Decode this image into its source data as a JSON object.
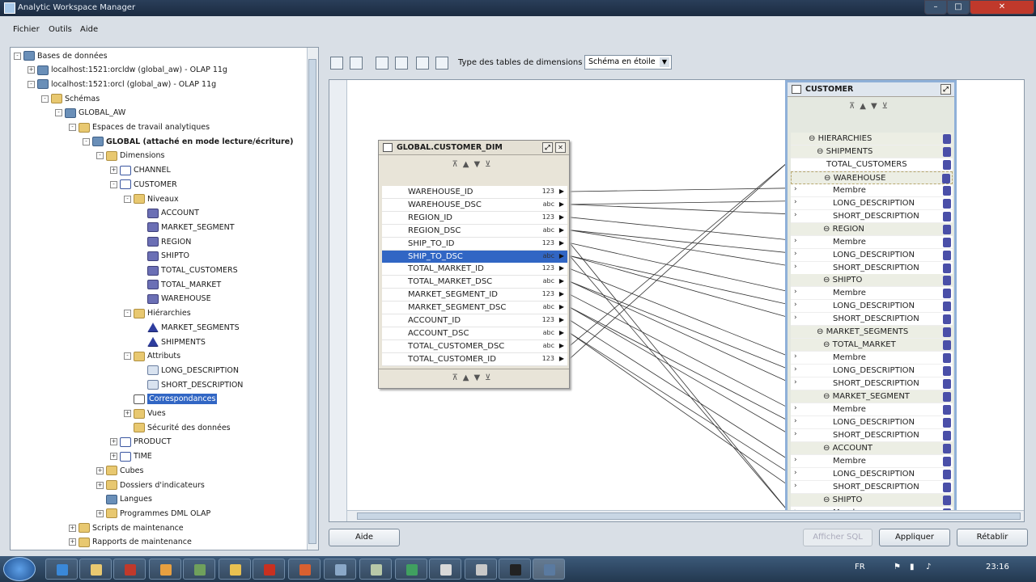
{
  "window": {
    "title": "Analytic Workspace Manager"
  },
  "menu": [
    "Fichier",
    "Outils",
    "Aide"
  ],
  "tree": [
    {
      "label": "Bases de données",
      "indent": 0,
      "icon": "db",
      "exp": "-"
    },
    {
      "label": "localhost:1521:orcldw (global_aw) - OLAP 11g",
      "indent": 1,
      "icon": "db",
      "exp": "+"
    },
    {
      "label": "localhost:1521:orcl (global_aw) - OLAP 11g",
      "indent": 1,
      "icon": "db",
      "exp": "-"
    },
    {
      "label": "Schémas",
      "indent": 2,
      "icon": "folder",
      "exp": "-"
    },
    {
      "label": "GLOBAL_AW",
      "indent": 3,
      "icon": "db",
      "exp": "-"
    },
    {
      "label": "Espaces de travail analytiques",
      "indent": 4,
      "icon": "folder",
      "exp": "-"
    },
    {
      "label": "GLOBAL (attaché en mode lecture/écriture)",
      "indent": 5,
      "icon": "db",
      "exp": "-",
      "bold": true
    },
    {
      "label": "Dimensions",
      "indent": 6,
      "icon": "folder",
      "exp": "-"
    },
    {
      "label": "CHANNEL",
      "indent": 7,
      "icon": "dim",
      "exp": "+"
    },
    {
      "label": "CUSTOMER",
      "indent": 7,
      "icon": "dim",
      "exp": "-"
    },
    {
      "label": "Niveaux",
      "indent": 8,
      "icon": "folder",
      "exp": "-"
    },
    {
      "label": "ACCOUNT",
      "indent": 9,
      "icon": "level",
      "exp": ""
    },
    {
      "label": "MARKET_SEGMENT",
      "indent": 9,
      "icon": "level",
      "exp": ""
    },
    {
      "label": "REGION",
      "indent": 9,
      "icon": "level",
      "exp": ""
    },
    {
      "label": "SHIPTO",
      "indent": 9,
      "icon": "level",
      "exp": ""
    },
    {
      "label": "TOTAL_CUSTOMERS",
      "indent": 9,
      "icon": "level",
      "exp": ""
    },
    {
      "label": "TOTAL_MARKET",
      "indent": 9,
      "icon": "level",
      "exp": ""
    },
    {
      "label": "WAREHOUSE",
      "indent": 9,
      "icon": "level",
      "exp": ""
    },
    {
      "label": "Hiérarchies",
      "indent": 8,
      "icon": "folder",
      "exp": "-"
    },
    {
      "label": "MARKET_SEGMENTS",
      "indent": 9,
      "icon": "hier",
      "exp": ""
    },
    {
      "label": "SHIPMENTS",
      "indent": 9,
      "icon": "hier",
      "exp": ""
    },
    {
      "label": "Attributs",
      "indent": 8,
      "icon": "folder",
      "exp": "-"
    },
    {
      "label": "LONG_DESCRIPTION",
      "indent": 9,
      "icon": "attr",
      "exp": ""
    },
    {
      "label": "SHORT_DESCRIPTION",
      "indent": 9,
      "icon": "attr",
      "exp": ""
    },
    {
      "label": "Correspondances",
      "indent": 8,
      "icon": "map",
      "exp": "",
      "selected": true
    },
    {
      "label": "Vues",
      "indent": 8,
      "icon": "folder",
      "exp": "+"
    },
    {
      "label": "Sécurité des données",
      "indent": 8,
      "icon": "folder",
      "exp": ""
    },
    {
      "label": "PRODUCT",
      "indent": 7,
      "icon": "dim",
      "exp": "+"
    },
    {
      "label": "TIME",
      "indent": 7,
      "icon": "dim",
      "exp": "+"
    },
    {
      "label": "Cubes",
      "indent": 6,
      "icon": "folder",
      "exp": "+"
    },
    {
      "label": "Dossiers d'indicateurs",
      "indent": 6,
      "icon": "folder",
      "exp": "+"
    },
    {
      "label": "Langues",
      "indent": 6,
      "icon": "db",
      "exp": ""
    },
    {
      "label": "Programmes DML OLAP",
      "indent": 6,
      "icon": "folder",
      "exp": "+"
    },
    {
      "label": "Scripts de maintenance",
      "indent": 4,
      "icon": "folder",
      "exp": "+"
    },
    {
      "label": "Rapports de maintenance",
      "indent": 4,
      "icon": "folder",
      "exp": "+"
    }
  ],
  "toolbar": {
    "label": "Type des tables de dimensions :",
    "select_value": "Schéma en étoile"
  },
  "source": {
    "title": "GLOBAL.CUSTOMER_DIM",
    "columns": [
      {
        "name": "WAREHOUSE_ID",
        "type": "123"
      },
      {
        "name": "WAREHOUSE_DSC",
        "type": "abc"
      },
      {
        "name": "REGION_ID",
        "type": "123"
      },
      {
        "name": "REGION_DSC",
        "type": "abc"
      },
      {
        "name": "SHIP_TO_ID",
        "type": "123"
      },
      {
        "name": "SHIP_TO_DSC",
        "type": "abc",
        "selected": true
      },
      {
        "name": "TOTAL_MARKET_ID",
        "type": "123"
      },
      {
        "name": "TOTAL_MARKET_DSC",
        "type": "abc"
      },
      {
        "name": "MARKET_SEGMENT_ID",
        "type": "123"
      },
      {
        "name": "MARKET_SEGMENT_DSC",
        "type": "abc"
      },
      {
        "name": "ACCOUNT_ID",
        "type": "123"
      },
      {
        "name": "ACCOUNT_DSC",
        "type": "abc"
      },
      {
        "name": "TOTAL_CUSTOMER_DSC",
        "type": "abc"
      },
      {
        "name": "TOTAL_CUSTOMER_ID",
        "type": "123"
      }
    ]
  },
  "target": {
    "title": "CUSTOMER",
    "rows": [
      {
        "label": "HIERARCHIES",
        "group": true,
        "x": 30,
        "mark": "⊖"
      },
      {
        "label": "SHIPMENTS",
        "group": true,
        "x": 40,
        "mark": "⊖"
      },
      {
        "label": "TOTAL_CUSTOMERS",
        "x": 52,
        "arrow": false
      },
      {
        "label": "WAREHOUSE",
        "group": true,
        "x": 48,
        "mark": "⊖",
        "dashed": true
      },
      {
        "label": "Membre",
        "x": 60,
        "arrow": true
      },
      {
        "label": "LONG_DESCRIPTION",
        "x": 60,
        "arrow": true
      },
      {
        "label": "SHORT_DESCRIPTION",
        "x": 60,
        "arrow": true
      },
      {
        "label": "REGION",
        "group": true,
        "x": 48,
        "mark": "⊖"
      },
      {
        "label": "Membre",
        "x": 60,
        "arrow": true
      },
      {
        "label": "LONG_DESCRIPTION",
        "x": 60,
        "arrow": true
      },
      {
        "label": "SHORT_DESCRIPTION",
        "x": 60,
        "arrow": true
      },
      {
        "label": "SHIPTO",
        "group": true,
        "x": 48,
        "mark": "⊖"
      },
      {
        "label": "Membre",
        "x": 60,
        "arrow": true
      },
      {
        "label": "LONG_DESCRIPTION",
        "x": 60,
        "arrow": true
      },
      {
        "label": "SHORT_DESCRIPTION",
        "x": 60,
        "arrow": true
      },
      {
        "label": "MARKET_SEGMENTS",
        "group": true,
        "x": 40,
        "mark": "⊖"
      },
      {
        "label": "TOTAL_MARKET",
        "group": true,
        "x": 48,
        "mark": "⊖"
      },
      {
        "label": "Membre",
        "x": 60,
        "arrow": true
      },
      {
        "label": "LONG_DESCRIPTION",
        "x": 60,
        "arrow": true
      },
      {
        "label": "SHORT_DESCRIPTION",
        "x": 60,
        "arrow": true
      },
      {
        "label": "MARKET_SEGMENT",
        "group": true,
        "x": 48,
        "mark": "⊖"
      },
      {
        "label": "Membre",
        "x": 60,
        "arrow": true
      },
      {
        "label": "LONG_DESCRIPTION",
        "x": 60,
        "arrow": true
      },
      {
        "label": "SHORT_DESCRIPTION",
        "x": 60,
        "arrow": true
      },
      {
        "label": "ACCOUNT",
        "group": true,
        "x": 48,
        "mark": "⊖"
      },
      {
        "label": "Membre",
        "x": 60,
        "arrow": true
      },
      {
        "label": "LONG_DESCRIPTION",
        "x": 60,
        "arrow": true
      },
      {
        "label": "SHORT_DESCRIPTION",
        "x": 60,
        "arrow": true
      },
      {
        "label": "SHIPTO",
        "group": true,
        "x": 48,
        "mark": "⊖"
      },
      {
        "label": "Membre",
        "x": 60,
        "arrow": true
      }
    ]
  },
  "buttons": {
    "help": "Aide",
    "sql": "Afficher SQL",
    "apply": "Appliquer",
    "reset": "Rétablir"
  },
  "taskbar": {
    "lang": "FR",
    "time": "23:16"
  },
  "colors": {
    "selection": "#3166c4",
    "title_bar": "#1b2b40"
  }
}
